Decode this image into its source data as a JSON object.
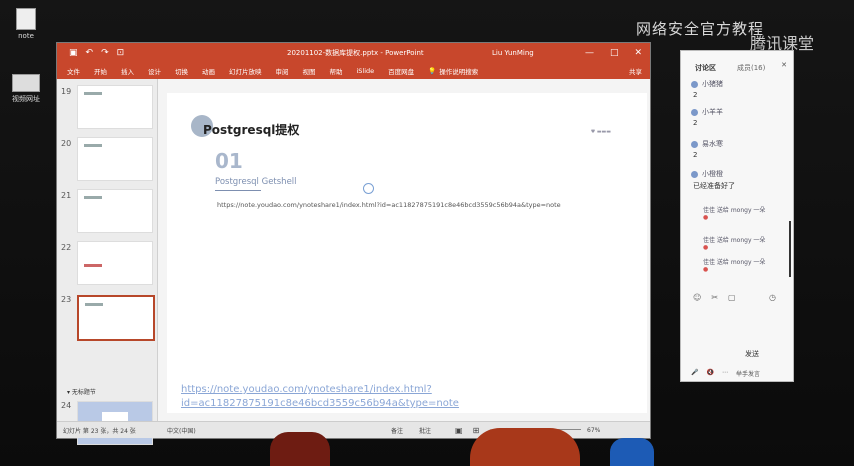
{
  "desktop": {
    "icons": [
      {
        "label": "note",
        "icon": "document-icon"
      },
      {
        "label": "视频网址",
        "icon": "video-file-icon"
      }
    ],
    "watermark": "网络安全官方教程",
    "watermark2": "腾讯课堂"
  },
  "powerpoint": {
    "quick_access": [
      "▣",
      "↶",
      "↷",
      "⊡"
    ],
    "title": "20201102-数据库提权.pptx - PowerPoint",
    "user": "Liu YunMing",
    "window_buttons": [
      "—",
      "□",
      "✕"
    ],
    "ribbon_tabs": [
      "文件",
      "开始",
      "插入",
      "设计",
      "切换",
      "动画",
      "幻灯片放映",
      "审阅",
      "视图",
      "帮助",
      "iSlide",
      "百度网盘"
    ],
    "search_placeholder": "操作说明搜索",
    "share": "共享",
    "thumbnails": [
      {
        "num": "19"
      },
      {
        "num": "20"
      },
      {
        "num": "21"
      },
      {
        "num": "22"
      },
      {
        "num": "23",
        "selected": true
      },
      {
        "num": "24"
      }
    ],
    "section_label": "▾ 无标题节",
    "slide": {
      "title": "Postgresql提权",
      "number": "01",
      "subtitle": "Postgresql Getshell",
      "url_small": "https://note.youdao.com/ynoteshare1/index.html?id=ac11827875191c8e46bcd3559c56b94a&type=note",
      "url_big": "https://note.youdao.com/ynoteshare1/index.html?id=ac11827875191c8e46bcd3559c56b94a&type=note"
    },
    "status": {
      "slide_info": "幻灯片 第 23 张，共 24 张",
      "language": "中文(中国)",
      "notes": "备注",
      "comments": "批注",
      "zoom": "67%"
    }
  },
  "discussion": {
    "tab": "讨论区",
    "count": "成员(16)",
    "messages": [
      {
        "name": "小猪猪",
        "value": "2"
      },
      {
        "name": "小羊羊",
        "value": "2"
      },
      {
        "name": "易水寒",
        "value": "2"
      },
      {
        "name": "小橙橙",
        "value": "已经准备好了"
      }
    ],
    "notes": [
      "佳佳 送给 mongy 一朵",
      "佳佳 送给 mongy 一朵",
      "佳佳 送给 mongy 一朵"
    ],
    "send_label": "发送",
    "bottom_items": [
      "🎤",
      "🔇",
      "⋯",
      "举手发言"
    ]
  }
}
